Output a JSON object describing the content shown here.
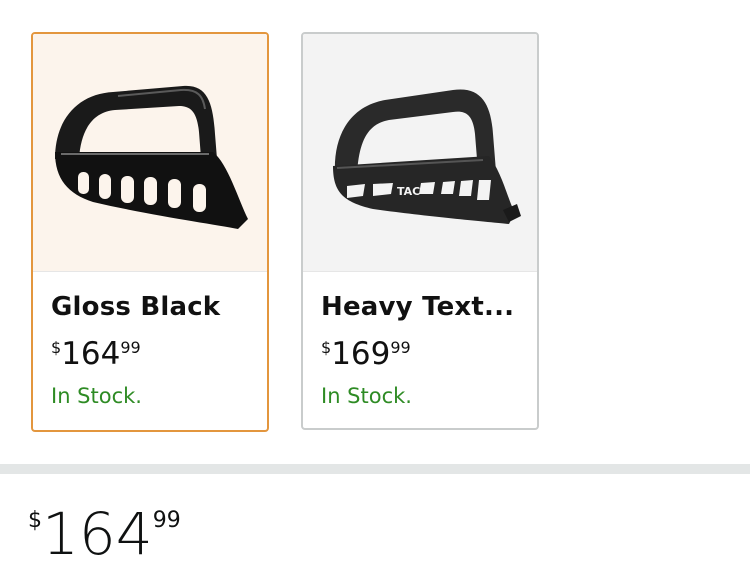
{
  "variants": [
    {
      "name": "Gloss Black",
      "price": {
        "symbol": "$",
        "whole": "164",
        "fraction": "99"
      },
      "availability": "In Stock.",
      "selected": true,
      "image_icon": "gloss-black-bull-bar-image"
    },
    {
      "name": "Heavy Text...",
      "price": {
        "symbol": "$",
        "whole": "169",
        "fraction": "99"
      },
      "availability": "In Stock.",
      "selected": false,
      "image_icon": "textured-black-bull-bar-image"
    }
  ],
  "main_price": {
    "symbol": "$",
    "whole": "164",
    "fraction": "99"
  },
  "colors": {
    "selected_border": "#e3963e",
    "unselected_border": "#c9cccc",
    "in_stock": "#2e8b24"
  }
}
